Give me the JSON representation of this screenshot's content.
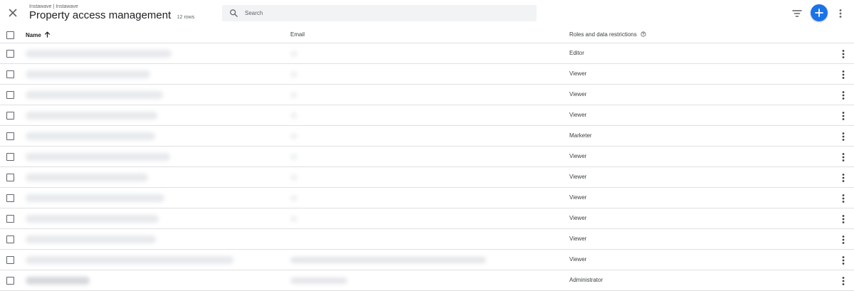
{
  "header": {
    "breadcrumb": "Instawave | Instawave",
    "title": "Property access management",
    "row_count": "12 rows"
  },
  "search": {
    "placeholder": "Search",
    "value": ""
  },
  "colors": {
    "accent": "#1a73e8",
    "divider": "#e0e0e0",
    "search_bg": "#f1f3f4"
  },
  "icons": {
    "close": "close-icon",
    "search": "search-icon",
    "filter": "filter-icon",
    "add": "add-icon",
    "more": "more-vert-icon",
    "sort": "arrow-upward-icon",
    "help": "help-outline-icon"
  },
  "table": {
    "columns": {
      "name": "Name",
      "email": "Email",
      "roles": "Roles and data restrictions"
    },
    "sort": {
      "column": "Name",
      "direction": "ascending"
    },
    "rows": [
      {
        "role": "Editor"
      },
      {
        "role": "Viewer"
      },
      {
        "role": "Viewer"
      },
      {
        "role": "Viewer"
      },
      {
        "role": "Marketer"
      },
      {
        "role": "Viewer"
      },
      {
        "role": "Viewer"
      },
      {
        "role": "Viewer"
      },
      {
        "role": "Viewer"
      },
      {
        "role": "Viewer"
      },
      {
        "role": "Viewer"
      },
      {
        "role": "Administrator"
      }
    ]
  }
}
